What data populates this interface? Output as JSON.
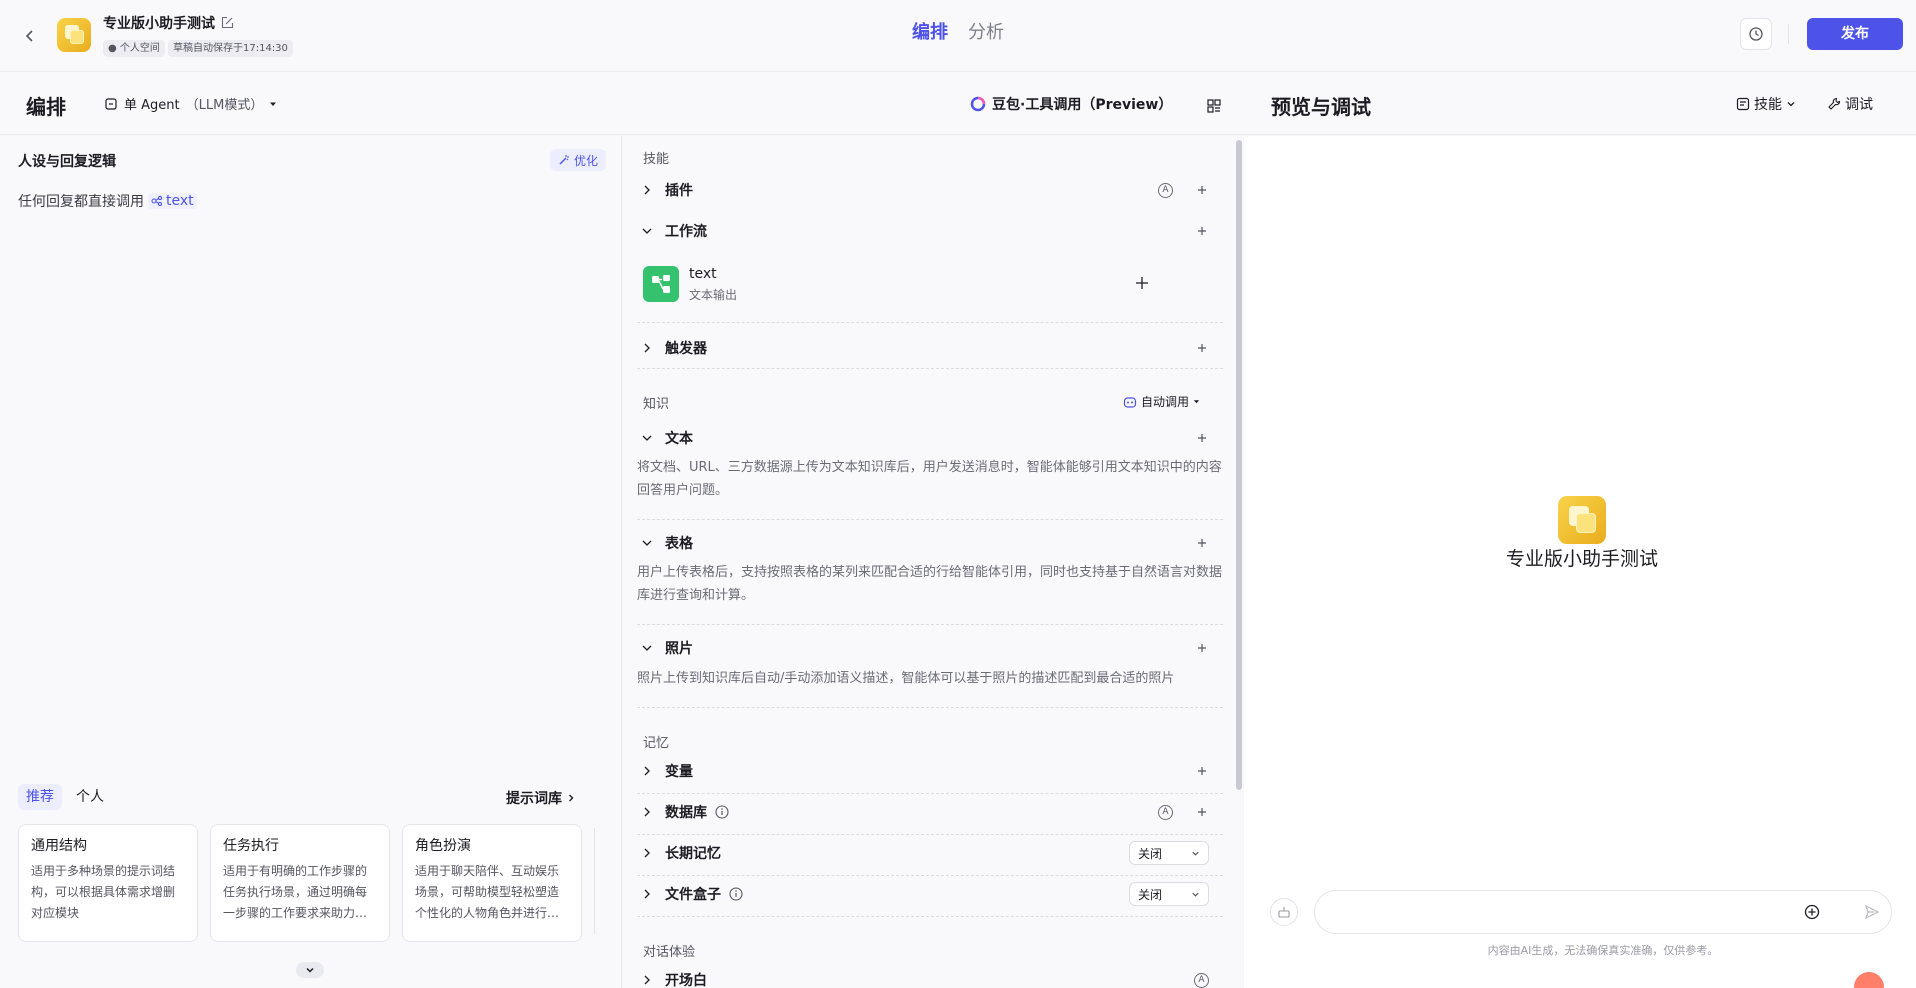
{
  "header": {
    "bot_name": "专业版小助手测试",
    "tag_space": "个人空间",
    "tag_autosave": "草稿自动保存于17:14:30",
    "tabs": [
      {
        "label": "编排",
        "active": true
      },
      {
        "label": "分析",
        "active": false
      }
    ],
    "publish_label": "发布"
  },
  "edit": {
    "title": "编排",
    "agent_mode": "单 Agent",
    "agent_mode_sub": "（LLM模式）",
    "model": "豆包·工具调用（Preview）"
  },
  "persona": {
    "title": "人设与回复逻辑",
    "optimize_label": "优化",
    "prompt_text": "任何回复都直接调用",
    "prompt_chip": "text",
    "lib_tabs": [
      {
        "label": "推荐",
        "active": true
      },
      {
        "label": "个人",
        "active": false
      }
    ],
    "prompt_lib_link": "提示词库",
    "cards": [
      {
        "title": "通用结构",
        "desc": "适用于多种场景的提示词结构，可以根据具体需求增删对应模块"
      },
      {
        "title": "任务执行",
        "desc": "适用于有明确的工作步骤的任务执行场景，通过明确每一步骤的工作要求来助力…"
      },
      {
        "title": "角色扮演",
        "desc": "适用于聊天陪伴、互动娱乐场景，可帮助模型轻松塑造个性化的人物角色并进行…"
      }
    ]
  },
  "skills": {
    "group_skill": "技能",
    "plugin": "插件",
    "workflow": "工作流",
    "workflow_item_name": "text",
    "workflow_item_sub": "文本输出",
    "trigger": "触发器",
    "group_knowledge": "知识",
    "auto_call": "自动调用",
    "text": "文本",
    "text_desc": "将文档、URL、三方数据源上传为文本知识库后，用户发送消息时，智能体能够引用文本知识中的内容回答用户问题。",
    "table": "表格",
    "table_desc": "用户上传表格后，支持按照表格的某列来匹配合适的行给智能体引用，同时也支持基于自然语言对数据库进行查询和计算。",
    "photo": "照片",
    "photo_desc": "照片上传到知识库后自动/手动添加语义描述，智能体可以基于照片的描述匹配到最合适的照片",
    "group_memory": "记忆",
    "variable": "变量",
    "database": "数据库",
    "long_memory": "长期记忆",
    "long_memory_value": "关闭",
    "file_box": "文件盒子",
    "file_box_value": "关闭",
    "group_dialog": "对话体验",
    "opening": "开场白"
  },
  "preview": {
    "title": "预览与调试",
    "skill_label": "技能",
    "debug_label": "调试",
    "bot_name": "专业版小助手测试",
    "input_value": "",
    "disclaimer": "内容由AI生成，无法确保真实准确，仅供参考。"
  }
}
